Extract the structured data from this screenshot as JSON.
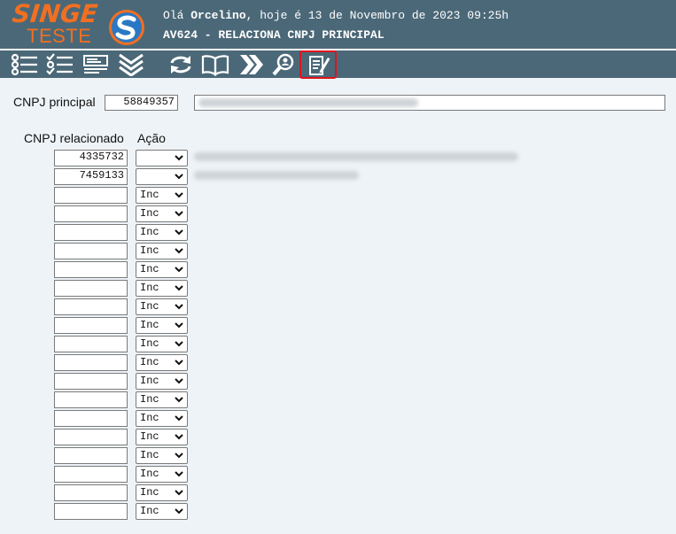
{
  "header": {
    "logo_top": "SINGE",
    "logo_bottom": "TESTE",
    "greeting_prefix": "Olá ",
    "user_name": "Orcelino",
    "greeting_suffix": ", hoje é 13 de Novembro de 2023 09:25h",
    "program_title": "AV624 - RELACIONA CNPJ PRINCIPAL",
    "colors": {
      "background": "#4b6878",
      "brand": "#f36f20"
    }
  },
  "toolbar": {
    "buttons": [
      {
        "icon": "list-icon"
      },
      {
        "icon": "checklist-icon"
      },
      {
        "icon": "form-icon"
      },
      {
        "icon": "chevrons-down-icon"
      },
      {
        "icon": "refresh-icon"
      },
      {
        "icon": "book-icon"
      },
      {
        "icon": "chevrons-right-icon"
      },
      {
        "icon": "search-icon"
      },
      {
        "icon": "edit-document-icon",
        "active": true
      }
    ],
    "active_color": "#e0141c"
  },
  "form": {
    "principal_label": "CNPJ principal",
    "principal_value": "58849357",
    "related_header": "CNPJ relacionado",
    "action_header": "Ação",
    "rows": [
      {
        "cnpj": "4335732",
        "action": ""
      },
      {
        "cnpj": "7459133",
        "action": ""
      },
      {
        "cnpj": "",
        "action": "Inc"
      },
      {
        "cnpj": "",
        "action": "Inc"
      },
      {
        "cnpj": "",
        "action": "Inc"
      },
      {
        "cnpj": "",
        "action": "Inc"
      },
      {
        "cnpj": "",
        "action": "Inc"
      },
      {
        "cnpj": "",
        "action": "Inc"
      },
      {
        "cnpj": "",
        "action": "Inc"
      },
      {
        "cnpj": "",
        "action": "Inc"
      },
      {
        "cnpj": "",
        "action": "Inc"
      },
      {
        "cnpj": "",
        "action": "Inc"
      },
      {
        "cnpj": "",
        "action": "Inc"
      },
      {
        "cnpj": "",
        "action": "Inc"
      },
      {
        "cnpj": "",
        "action": "Inc"
      },
      {
        "cnpj": "",
        "action": "Inc"
      },
      {
        "cnpj": "",
        "action": "Inc"
      },
      {
        "cnpj": "",
        "action": "Inc"
      },
      {
        "cnpj": "",
        "action": "Inc"
      },
      {
        "cnpj": "",
        "action": "Inc"
      }
    ]
  }
}
